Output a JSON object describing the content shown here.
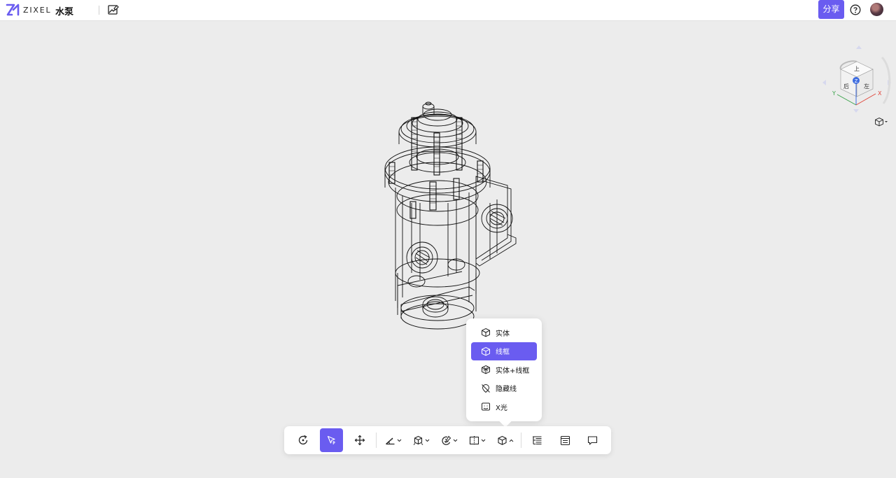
{
  "header": {
    "logo_text": "ZIXEL",
    "doc_title": "水泵",
    "share_label": "分享"
  },
  "viewcube": {
    "faces": {
      "top": "上",
      "front": "后",
      "right": "左",
      "axis_z": "Z"
    },
    "axes": {
      "x": "X",
      "y": "Y"
    },
    "colors": {
      "x": "#e0463c",
      "y": "#3aa34a",
      "z": "#3c6be0"
    }
  },
  "display_menu": {
    "items": [
      {
        "label": "实体",
        "icon": "solid-cube-icon",
        "selected": false
      },
      {
        "label": "线框",
        "icon": "wireframe-cube-icon",
        "selected": true
      },
      {
        "label": "实体+线框",
        "icon": "solid-wireframe-icon",
        "selected": false
      },
      {
        "label": "隐藏线",
        "icon": "hidden-line-icon",
        "selected": false
      },
      {
        "label": "X光",
        "icon": "xray-icon",
        "selected": false
      }
    ]
  },
  "toolbar": {
    "tools": [
      {
        "name": "rotate",
        "icon": "rotate-icon"
      },
      {
        "name": "select",
        "icon": "select-cursor-icon",
        "active": true
      },
      {
        "name": "pan",
        "icon": "move-icon"
      },
      {
        "name": "measure",
        "icon": "measure-icon",
        "dropdown": true
      },
      {
        "name": "explode",
        "icon": "explode-icon",
        "dropdown": true
      },
      {
        "name": "material",
        "icon": "material-icon",
        "dropdown": true
      },
      {
        "name": "section",
        "icon": "section-icon",
        "dropdown": true
      },
      {
        "name": "display-mode",
        "icon": "cube-icon",
        "dropdown": true,
        "open": true
      },
      {
        "name": "model-tree",
        "icon": "tree-icon"
      },
      {
        "name": "properties",
        "icon": "properties-icon"
      },
      {
        "name": "comments",
        "icon": "comment-icon"
      }
    ]
  },
  "colors": {
    "accent": "#6a5cf0",
    "canvas": "#ececec"
  }
}
